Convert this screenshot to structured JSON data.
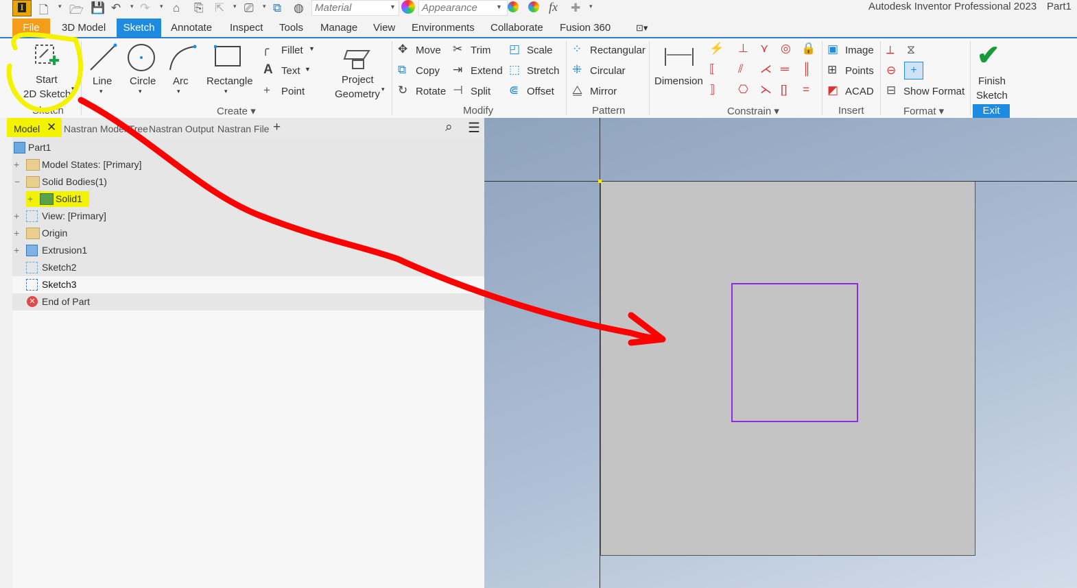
{
  "app": {
    "title": "Autodesk Inventor Professional 2023",
    "document": "Part1"
  },
  "quick_access": {
    "material_placeholder": "Material",
    "appearance_placeholder": "Appearance",
    "fx_label": "fx"
  },
  "tabs": [
    {
      "label": "File"
    },
    {
      "label": "3D Model"
    },
    {
      "label": "Sketch"
    },
    {
      "label": "Annotate"
    },
    {
      "label": "Inspect"
    },
    {
      "label": "Tools"
    },
    {
      "label": "Manage"
    },
    {
      "label": "View"
    },
    {
      "label": "Environments"
    },
    {
      "label": "Collaborate"
    },
    {
      "label": "Fusion 360"
    }
  ],
  "ribbon": {
    "sketch_group": {
      "start_line1": "Start",
      "start_line2": "2D Sketch",
      "label": "Sketch"
    },
    "create": {
      "line": "Line",
      "circle": "Circle",
      "arc": "Arc",
      "rectangle": "Rectangle",
      "fillet": "Fillet",
      "text": "Text",
      "point": "Point",
      "project_line1": "Project",
      "project_line2": "Geometry",
      "label": "Create"
    },
    "modify": {
      "move": "Move",
      "copy": "Copy",
      "rotate": "Rotate",
      "trim": "Trim",
      "extend": "Extend",
      "split": "Split",
      "scale": "Scale",
      "stretch": "Stretch",
      "offset": "Offset",
      "label": "Modify"
    },
    "pattern": {
      "rectangular": "Rectangular",
      "circular": "Circular",
      "mirror": "Mirror",
      "label": "Pattern"
    },
    "constrain": {
      "dimension": "Dimension",
      "label": "Constrain"
    },
    "insert": {
      "image": "Image",
      "points": "Points",
      "acad": "ACAD",
      "label": "Insert"
    },
    "format": {
      "show_format": "Show Format",
      "label": "Format"
    },
    "exit": {
      "finish_line1": "Finish",
      "finish_line2": "Sketch",
      "label": "Exit"
    }
  },
  "browser": {
    "tabs": [
      {
        "label": "Model"
      },
      {
        "label": "Nastran Model Tree"
      },
      {
        "label": "Nastran Output"
      },
      {
        "label": "Nastran File"
      }
    ],
    "tree": [
      {
        "label": "Part1"
      },
      {
        "label": "Model States: [Primary]"
      },
      {
        "label": "Solid Bodies(1)"
      },
      {
        "label": "Solid1"
      },
      {
        "label": "View: [Primary]"
      },
      {
        "label": "Origin"
      },
      {
        "label": "Extrusion1"
      },
      {
        "label": "Sketch2"
      },
      {
        "label": "Sketch3"
      },
      {
        "label": "End of Part"
      }
    ]
  },
  "colors": {
    "accent": "#1e8ae0",
    "sketch_profile": "#8b2be2",
    "annotation_arrow": "#ff0000",
    "highlight": "#f3f300",
    "finish_check": "#1a9a3a"
  }
}
